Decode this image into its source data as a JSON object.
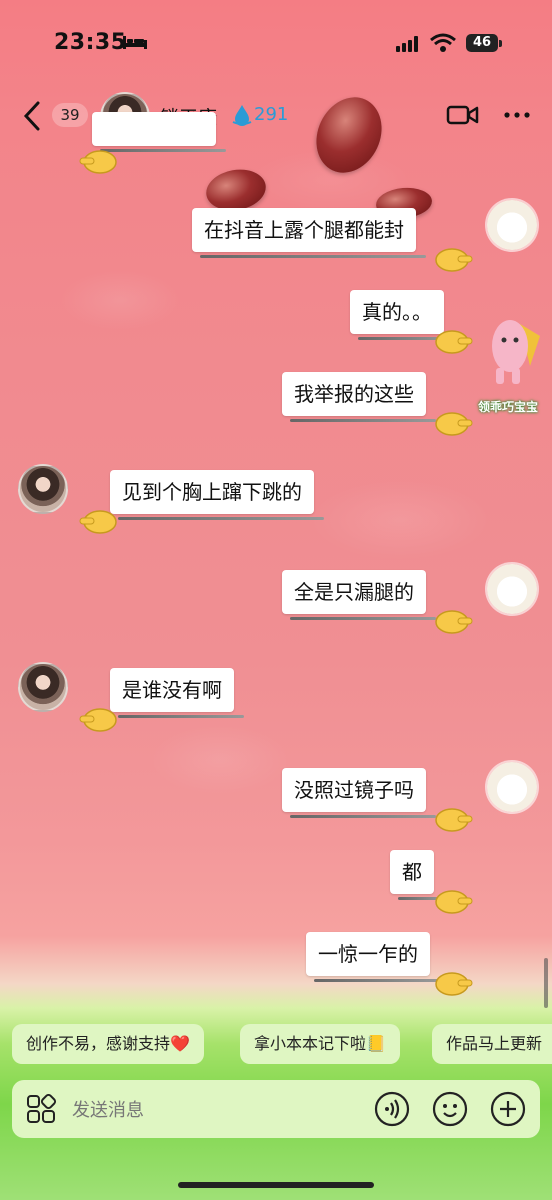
{
  "status_bar": {
    "time": "23:35",
    "battery": "46"
  },
  "header": {
    "unread_count": "39",
    "contact_name": "锁平康",
    "score": "291"
  },
  "messages": [
    {
      "side": "left",
      "text": ""
    },
    {
      "side": "right",
      "text": "在抖音上露个腿都能封"
    },
    {
      "side": "right",
      "text": "真的。。"
    },
    {
      "side": "right",
      "text": "我举报的这些"
    },
    {
      "side": "left",
      "text": "见到个胸上蹿下跳的"
    },
    {
      "side": "right",
      "text": "全是只漏腿的"
    },
    {
      "side": "left",
      "text": "是谁没有啊"
    },
    {
      "side": "right",
      "text": "没照过镜子吗"
    },
    {
      "side": "right",
      "text": "都"
    },
    {
      "side": "right",
      "text": "一惊一乍的"
    }
  ],
  "mascot_label": "领乖巧宝宝",
  "quick_replies": [
    "创作不易，感谢支持❤️",
    "拿小本本记下啦📒",
    "作品马上更新"
  ],
  "input": {
    "placeholder": "发送消息"
  },
  "colors": {
    "chip_bg": "#dff6c2",
    "score_blue": "#2b9bd6"
  }
}
